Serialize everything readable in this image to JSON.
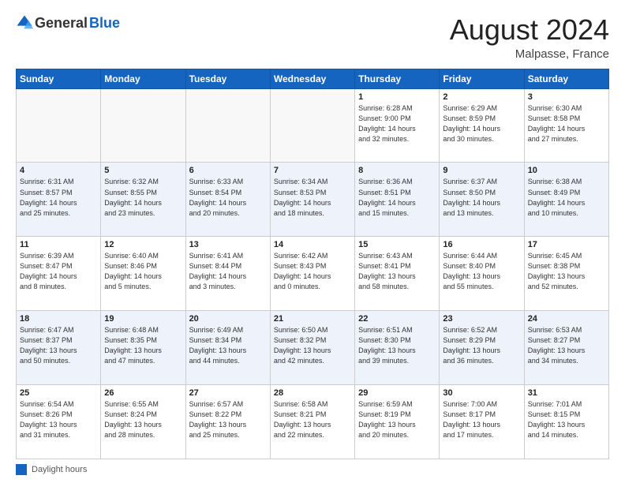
{
  "logo": {
    "general": "General",
    "blue": "Blue"
  },
  "title": "August 2024",
  "location": "Malpasse, France",
  "days_of_week": [
    "Sunday",
    "Monday",
    "Tuesday",
    "Wednesday",
    "Thursday",
    "Friday",
    "Saturday"
  ],
  "footer_label": "Daylight hours",
  "weeks": [
    [
      {
        "day": "",
        "info": ""
      },
      {
        "day": "",
        "info": ""
      },
      {
        "day": "",
        "info": ""
      },
      {
        "day": "",
        "info": ""
      },
      {
        "day": "1",
        "info": "Sunrise: 6:28 AM\nSunset: 9:00 PM\nDaylight: 14 hours\nand 32 minutes."
      },
      {
        "day": "2",
        "info": "Sunrise: 6:29 AM\nSunset: 8:59 PM\nDaylight: 14 hours\nand 30 minutes."
      },
      {
        "day": "3",
        "info": "Sunrise: 6:30 AM\nSunset: 8:58 PM\nDaylight: 14 hours\nand 27 minutes."
      }
    ],
    [
      {
        "day": "4",
        "info": "Sunrise: 6:31 AM\nSunset: 8:57 PM\nDaylight: 14 hours\nand 25 minutes."
      },
      {
        "day": "5",
        "info": "Sunrise: 6:32 AM\nSunset: 8:55 PM\nDaylight: 14 hours\nand 23 minutes."
      },
      {
        "day": "6",
        "info": "Sunrise: 6:33 AM\nSunset: 8:54 PM\nDaylight: 14 hours\nand 20 minutes."
      },
      {
        "day": "7",
        "info": "Sunrise: 6:34 AM\nSunset: 8:53 PM\nDaylight: 14 hours\nand 18 minutes."
      },
      {
        "day": "8",
        "info": "Sunrise: 6:36 AM\nSunset: 8:51 PM\nDaylight: 14 hours\nand 15 minutes."
      },
      {
        "day": "9",
        "info": "Sunrise: 6:37 AM\nSunset: 8:50 PM\nDaylight: 14 hours\nand 13 minutes."
      },
      {
        "day": "10",
        "info": "Sunrise: 6:38 AM\nSunset: 8:49 PM\nDaylight: 14 hours\nand 10 minutes."
      }
    ],
    [
      {
        "day": "11",
        "info": "Sunrise: 6:39 AM\nSunset: 8:47 PM\nDaylight: 14 hours\nand 8 minutes."
      },
      {
        "day": "12",
        "info": "Sunrise: 6:40 AM\nSunset: 8:46 PM\nDaylight: 14 hours\nand 5 minutes."
      },
      {
        "day": "13",
        "info": "Sunrise: 6:41 AM\nSunset: 8:44 PM\nDaylight: 14 hours\nand 3 minutes."
      },
      {
        "day": "14",
        "info": "Sunrise: 6:42 AM\nSunset: 8:43 PM\nDaylight: 14 hours\nand 0 minutes."
      },
      {
        "day": "15",
        "info": "Sunrise: 6:43 AM\nSunset: 8:41 PM\nDaylight: 13 hours\nand 58 minutes."
      },
      {
        "day": "16",
        "info": "Sunrise: 6:44 AM\nSunset: 8:40 PM\nDaylight: 13 hours\nand 55 minutes."
      },
      {
        "day": "17",
        "info": "Sunrise: 6:45 AM\nSunset: 8:38 PM\nDaylight: 13 hours\nand 52 minutes."
      }
    ],
    [
      {
        "day": "18",
        "info": "Sunrise: 6:47 AM\nSunset: 8:37 PM\nDaylight: 13 hours\nand 50 minutes."
      },
      {
        "day": "19",
        "info": "Sunrise: 6:48 AM\nSunset: 8:35 PM\nDaylight: 13 hours\nand 47 minutes."
      },
      {
        "day": "20",
        "info": "Sunrise: 6:49 AM\nSunset: 8:34 PM\nDaylight: 13 hours\nand 44 minutes."
      },
      {
        "day": "21",
        "info": "Sunrise: 6:50 AM\nSunset: 8:32 PM\nDaylight: 13 hours\nand 42 minutes."
      },
      {
        "day": "22",
        "info": "Sunrise: 6:51 AM\nSunset: 8:30 PM\nDaylight: 13 hours\nand 39 minutes."
      },
      {
        "day": "23",
        "info": "Sunrise: 6:52 AM\nSunset: 8:29 PM\nDaylight: 13 hours\nand 36 minutes."
      },
      {
        "day": "24",
        "info": "Sunrise: 6:53 AM\nSunset: 8:27 PM\nDaylight: 13 hours\nand 34 minutes."
      }
    ],
    [
      {
        "day": "25",
        "info": "Sunrise: 6:54 AM\nSunset: 8:26 PM\nDaylight: 13 hours\nand 31 minutes."
      },
      {
        "day": "26",
        "info": "Sunrise: 6:55 AM\nSunset: 8:24 PM\nDaylight: 13 hours\nand 28 minutes."
      },
      {
        "day": "27",
        "info": "Sunrise: 6:57 AM\nSunset: 8:22 PM\nDaylight: 13 hours\nand 25 minutes."
      },
      {
        "day": "28",
        "info": "Sunrise: 6:58 AM\nSunset: 8:21 PM\nDaylight: 13 hours\nand 22 minutes."
      },
      {
        "day": "29",
        "info": "Sunrise: 6:59 AM\nSunset: 8:19 PM\nDaylight: 13 hours\nand 20 minutes."
      },
      {
        "day": "30",
        "info": "Sunrise: 7:00 AM\nSunset: 8:17 PM\nDaylight: 13 hours\nand 17 minutes."
      },
      {
        "day": "31",
        "info": "Sunrise: 7:01 AM\nSunset: 8:15 PM\nDaylight: 13 hours\nand 14 minutes."
      }
    ]
  ]
}
